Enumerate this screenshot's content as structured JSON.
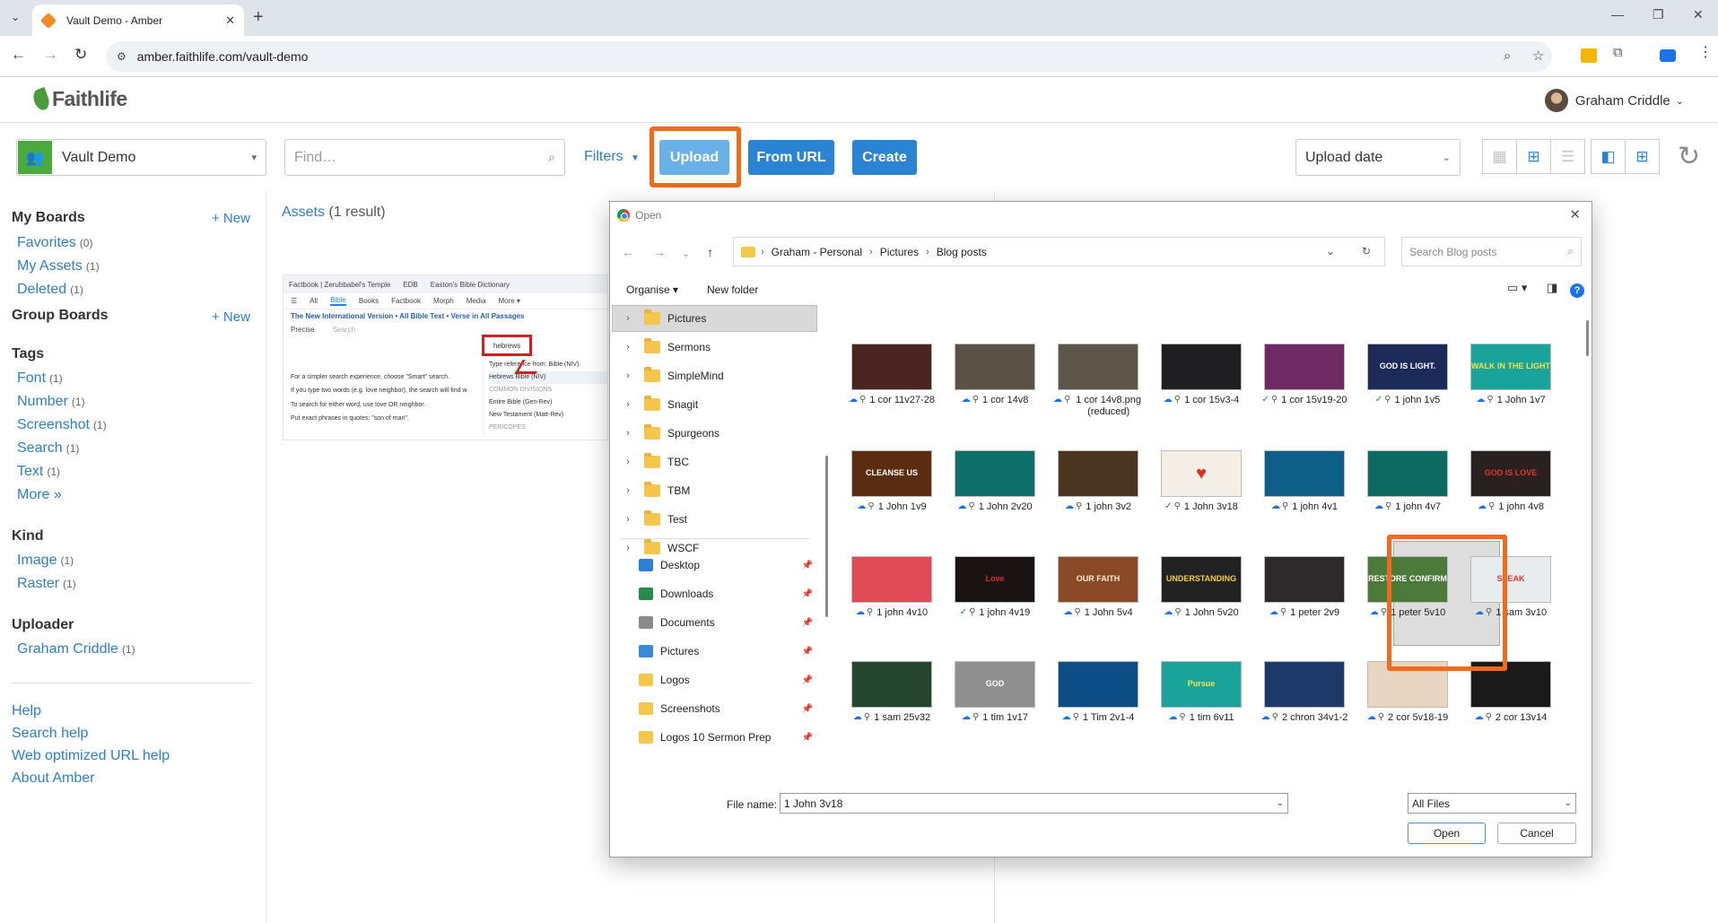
{
  "browser": {
    "tab_title": "Vault Demo - Amber",
    "url": "amber.faithlife.com/vault-demo"
  },
  "header": {
    "logo": "Faithlife",
    "user_name": "Graham Criddle"
  },
  "toolbar": {
    "vault_name": "Vault Demo",
    "find_placeholder": "Find…",
    "filters_label": "Filters",
    "upload_label": "Upload",
    "from_url_label": "From URL",
    "create_label": "Create",
    "sort_label": "Upload date"
  },
  "sidebar": {
    "my_boards": {
      "title": "My Boards",
      "new_label": "+ New",
      "items": [
        {
          "label": "Favorites",
          "count": "(0)"
        },
        {
          "label": "My Assets",
          "count": "(1)"
        },
        {
          "label": "Deleted",
          "count": "(1)"
        }
      ]
    },
    "group_boards": {
      "title": "Group Boards",
      "new_label": "+ New"
    },
    "tags": {
      "title": "Tags",
      "items": [
        {
          "label": "Font",
          "count": "(1)"
        },
        {
          "label": "Number",
          "count": "(1)"
        },
        {
          "label": "Screenshot",
          "count": "(1)"
        },
        {
          "label": "Search",
          "count": "(1)"
        },
        {
          "label": "Text",
          "count": "(1)"
        }
      ],
      "more": "More »"
    },
    "kind": {
      "title": "Kind",
      "items": [
        {
          "label": "Image",
          "count": "(1)"
        },
        {
          "label": "Raster",
          "count": "(1)"
        }
      ]
    },
    "uploader": {
      "title": "Uploader",
      "items": [
        {
          "label": "Graham Criddle",
          "count": "(1)"
        }
      ]
    },
    "help_links": [
      "Help",
      "Search help",
      "Web optimized URL help",
      "About Amber"
    ]
  },
  "main": {
    "assets_label": "Assets",
    "result_count": "(1 result)",
    "thumb": {
      "tabs": [
        "Factbook | Zerubbabel's Temple",
        "EDB",
        "Easton's Bible Dictionary"
      ],
      "nav": [
        "All",
        "Bible",
        "Books",
        "Factbook",
        "Morph",
        "Media",
        "More ▾"
      ],
      "line1": "The New International Version • All Bible Text • Verse in All Passages",
      "precise": "Precise",
      "search_placeholder": "Search",
      "hebrews": "hebrews",
      "hints": [
        "For a simpler search experience, choose \"Smart\" search.",
        "If you type two words (e.g. love neighbor), the search will find w",
        "To search for either word, use love OR neighbor.",
        "Put exact phrases in quotes: \"son of man\"."
      ],
      "suggest": [
        "Type reference from: Bible (NIV).",
        "Hebrews Bible (NIV)",
        "COMMON DIVISIONS",
        "Entire Bible (Gen-Rev)",
        "New Testament (Matt-Rev)",
        "PERICOPES"
      ]
    }
  },
  "dialog": {
    "title": "Open",
    "breadcrumb": [
      "Graham - Personal",
      "Pictures",
      "Blog posts"
    ],
    "search_placeholder": "Search Blog posts",
    "organise_label": "Organise",
    "new_folder_label": "New folder",
    "tree_folders": [
      "Pictures",
      "Sermons",
      "SimpleMind",
      "Snagit",
      "Spurgeons",
      "TBC",
      "TBM",
      "Test",
      "WSCF"
    ],
    "quick_access": [
      "Desktop",
      "Downloads",
      "Documents",
      "Pictures",
      "Logos",
      "Screenshots",
      "Logos 10 Sermon Prep"
    ],
    "files": [
      {
        "name": "1 cor 11v27-28",
        "status": "cloud",
        "thumb_text": "",
        "bg": "#4a2420",
        "fg": "#e8d2b0"
      },
      {
        "name": "1 cor 14v8",
        "status": "cloud",
        "thumb_text": "",
        "bg": "#5a5247",
        "fg": "#e8e0cf"
      },
      {
        "name": "1 cor 14v8.png (reduced)",
        "status": "cloud",
        "thumb_text": "",
        "bg": "#5e564b",
        "fg": "#e8e0cf"
      },
      {
        "name": "1 cor 15v3-4",
        "status": "cloud",
        "thumb_text": "",
        "bg": "#1f1f22",
        "fg": "#ddd"
      },
      {
        "name": "1 cor 15v19-20",
        "status": "ok",
        "thumb_text": "",
        "bg": "#6f2a63",
        "fg": "#f0d8ec"
      },
      {
        "name": "1 john 1v5",
        "status": "ok",
        "thumb_text": "GOD IS LIGHT.",
        "bg": "#1c2a5a",
        "fg": "#ffffff"
      },
      {
        "name": "1 John 1v7",
        "status": "cloud",
        "thumb_text": "WALK IN THE LIGHT",
        "bg": "#1aa39a",
        "fg": "#f5e14a"
      },
      {
        "name": "1 John 1v9",
        "status": "cloud",
        "thumb_text": "CLEANSE US",
        "bg": "#5a2c10",
        "fg": "#ffffff"
      },
      {
        "name": "1 John 2v20",
        "status": "cloud",
        "thumb_text": "",
        "bg": "#0f6f6a",
        "fg": "#d8f5ef"
      },
      {
        "name": "1 john 3v2",
        "status": "cloud",
        "thumb_text": "",
        "bg": "#4a3620",
        "fg": "#f0d6a8"
      },
      {
        "name": "1 John 3v18",
        "status": "ok",
        "thumb_text": "",
        "bg": "#f4efe6",
        "fg": "#d8322b"
      },
      {
        "name": "1 john 4v1",
        "status": "cloud",
        "thumb_text": "",
        "bg": "#0d5f88",
        "fg": "#dcefff"
      },
      {
        "name": "1 john 4v7",
        "status": "cloud",
        "thumb_text": "",
        "bg": "#0c6a60",
        "fg": "#dcf8f0"
      },
      {
        "name": "1 john 4v8",
        "status": "cloud",
        "thumb_text": "GOD IS LOVE",
        "bg": "#2a2020",
        "fg": "#e0392b"
      },
      {
        "name": "1 john 4v10",
        "status": "cloud",
        "thumb_text": "",
        "bg": "#e04a57",
        "fg": "#ffffff"
      },
      {
        "name": "1 john 4v19",
        "status": "ok",
        "thumb_text": "Love",
        "bg": "#1a1313",
        "fg": "#e02a2a"
      },
      {
        "name": "1 John 5v4",
        "status": "cloud",
        "thumb_text": "OUR FAITH",
        "bg": "#8a4a28",
        "fg": "#ffe9cf"
      },
      {
        "name": "1 John 5v20",
        "status": "cloud",
        "thumb_text": "UNDERSTANDING",
        "bg": "#222222",
        "fg": "#f2d03b"
      },
      {
        "name": "1 peter 2v9",
        "status": "cloud",
        "thumb_text": "",
        "bg": "#2c2a2a",
        "fg": "#e8c06a"
      },
      {
        "name": "1 peter 5v10",
        "status": "cloud",
        "thumb_text": "RESTORE CONFIRM",
        "bg": "#4c7a3a",
        "fg": "#ffffff"
      },
      {
        "name": "1 sam 3v10",
        "status": "cloud",
        "thumb_text": "SPEAK",
        "bg": "#e9ecef",
        "fg": "#e0392b"
      },
      {
        "name": "1 sam 25v32",
        "status": "cloud",
        "thumb_text": "",
        "bg": "#24462e",
        "fg": "#e8f5e0"
      },
      {
        "name": "1 tim 1v17",
        "status": "cloud",
        "thumb_text": "GOD",
        "bg": "#8f8f8f",
        "fg": "#ffffff"
      },
      {
        "name": "1 Tim 2v1-4",
        "status": "cloud",
        "thumb_text": "",
        "bg": "#0e4e86",
        "fg": "#dcefff"
      },
      {
        "name": "1 tim 6v11",
        "status": "cloud",
        "thumb_text": "Pursue",
        "bg": "#1aa39a",
        "fg": "#f5e14a"
      },
      {
        "name": "2 chron 34v1-2",
        "status": "cloud",
        "thumb_text": "",
        "bg": "#1e3a6a",
        "fg": "#dcefff"
      },
      {
        "name": "2 cor 5v18-19",
        "status": "cloud",
        "thumb_text": "",
        "bg": "#e9d6c2",
        "fg": "#8a4a28"
      },
      {
        "name": "2 cor 13v14",
        "status": "cloud",
        "thumb_text": "",
        "bg": "#1a1a1a",
        "fg": "#e0392b"
      }
    ],
    "file_name_label": "File name:",
    "file_name_value": "1 John 3v18",
    "file_type": "All Files",
    "open_label": "Open",
    "cancel_label": "Cancel"
  }
}
